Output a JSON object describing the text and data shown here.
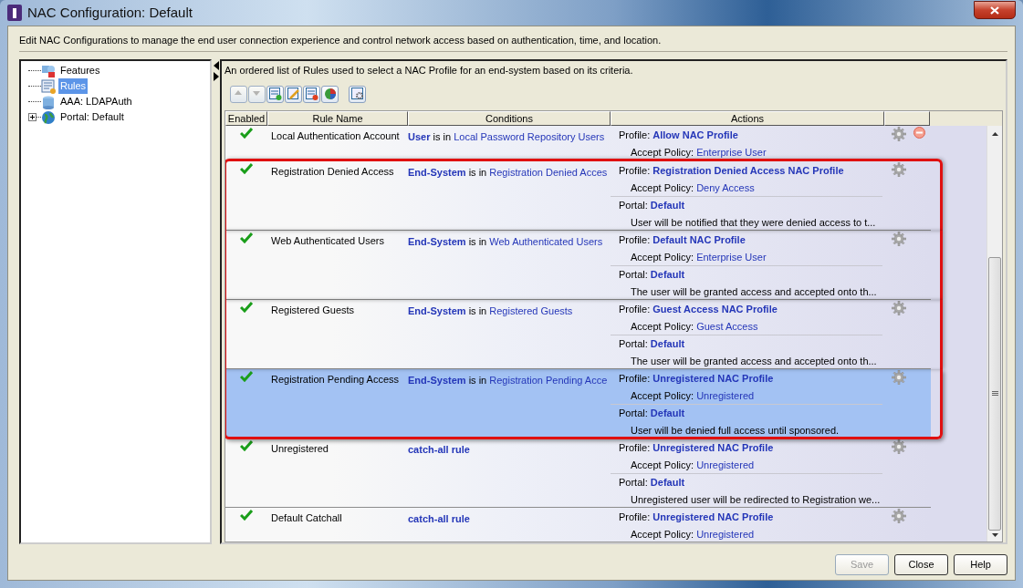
{
  "window": {
    "title": "NAC Configuration: Default"
  },
  "description": "Edit NAC Configurations to manage the end user connection experience and control network access based on authentication, time, and location.",
  "tree": [
    {
      "label": "Features",
      "kind": "features",
      "selected": false
    },
    {
      "label": "Rules",
      "kind": "rules",
      "selected": true
    },
    {
      "label": "AAA: LDAPAuth",
      "kind": "aaa",
      "selected": false
    },
    {
      "label": "Portal: Default",
      "kind": "portal",
      "selected": false,
      "expandable": true
    }
  ],
  "rules_panel": {
    "intro": "An ordered list of Rules used to select a NAC Profile for an end-system based on its criteria.",
    "toolbar": [
      {
        "kind": "up",
        "disabled": true
      },
      {
        "kind": "down",
        "disabled": true
      },
      {
        "kind": "add",
        "disabled": false
      },
      {
        "kind": "edit",
        "disabled": false
      },
      {
        "kind": "remove",
        "disabled": false
      },
      {
        "kind": "chart",
        "disabled": false
      },
      {
        "kind": "settings",
        "disabled": false
      }
    ],
    "columns": [
      "Enabled",
      "Rule Name",
      "Conditions",
      "Actions"
    ],
    "rules": [
      {
        "enabled": true,
        "name": "Local Authentication Account",
        "condition": {
          "subject": "User",
          "verb": "is in",
          "group": "Local Password Repository Users"
        },
        "profile_label": "Profile:",
        "profile": "Allow NAC Profile",
        "policy_label": "Accept Policy:",
        "policy": "Enterprise User",
        "removable": true,
        "selected": false,
        "highlighted": false
      },
      {
        "enabled": true,
        "name": "Registration Denied Access",
        "condition": {
          "subject": "End-System",
          "verb": "is in",
          "group": "Registration Denied Acces"
        },
        "profile_label": "Profile:",
        "profile": "Registration Denied Access NAC Profile",
        "policy_label": "Accept Policy:",
        "policy": "Deny Access",
        "portal_label": "Portal:",
        "portal": "Default",
        "portal_note": "User will be notified that they were denied access to t...",
        "removable": false,
        "selected": false,
        "highlighted": true
      },
      {
        "enabled": true,
        "name": "Web Authenticated Users",
        "condition": {
          "subject": "End-System",
          "verb": "is in",
          "group": "Web Authenticated Users"
        },
        "profile_label": "Profile:",
        "profile": "Default NAC Profile",
        "policy_label": "Accept Policy:",
        "policy": "Enterprise User",
        "portal_label": "Portal:",
        "portal": "Default",
        "portal_note": "The user will be granted access and accepted onto th...",
        "removable": false,
        "selected": false,
        "highlighted": true
      },
      {
        "enabled": true,
        "name": "Registered Guests",
        "condition": {
          "subject": "End-System",
          "verb": "is in",
          "group": "Registered Guests"
        },
        "profile_label": "Profile:",
        "profile": "Guest Access NAC Profile",
        "policy_label": "Accept Policy:",
        "policy": "Guest Access",
        "portal_label": "Portal:",
        "portal": "Default",
        "portal_note": "The user will be granted access and accepted onto th...",
        "removable": false,
        "selected": false,
        "highlighted": true
      },
      {
        "enabled": true,
        "name": "Registration Pending Access",
        "condition": {
          "subject": "End-System",
          "verb": "is in",
          "group": "Registration Pending Acce"
        },
        "profile_label": "Profile:",
        "profile": "Unregistered NAC Profile",
        "policy_label": "Accept Policy:",
        "policy": "Unregistered",
        "portal_label": "Portal:",
        "portal": "Default",
        "portal_note": "User will be denied full access until sponsored.",
        "removable": false,
        "selected": true,
        "highlighted": true
      },
      {
        "enabled": true,
        "name": "Unregistered",
        "condition": {
          "subject": "catch-all rule"
        },
        "profile_label": "Profile:",
        "profile": "Unregistered NAC Profile",
        "policy_label": "Accept Policy:",
        "policy": "Unregistered",
        "portal_label": "Portal:",
        "portal": "Default",
        "portal_note": "Unregistered user will be redirected to Registration we...",
        "removable": false,
        "selected": false,
        "highlighted": false
      },
      {
        "enabled": true,
        "name": "Default Catchall",
        "condition": {
          "subject": "catch-all rule"
        },
        "profile_label": "Profile:",
        "profile": "Unregistered NAC Profile",
        "policy_label": "Accept Policy:",
        "policy": "Unregistered",
        "removable": false,
        "selected": false,
        "highlighted": false
      }
    ]
  },
  "buttons": [
    {
      "label": "Save",
      "disabled": true
    },
    {
      "label": "Close",
      "disabled": false
    },
    {
      "label": "Help",
      "disabled": false
    }
  ]
}
